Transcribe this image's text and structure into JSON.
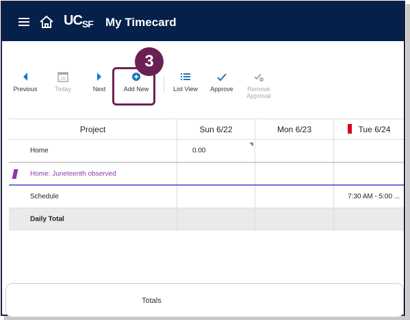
{
  "header": {
    "logo": "UCSF",
    "logo_main": "UC",
    "logo_sub": "SF",
    "title": "My Timecard",
    "background": "#052049"
  },
  "toolbar": {
    "previous": "Previous",
    "today": "Today",
    "today_date": "26",
    "next": "Next",
    "add_new": "Add New",
    "list_view": "List View",
    "approve": "Approve",
    "remove_approval": "Remove Approval",
    "accent": "#1a76c2"
  },
  "callout": {
    "number": "3",
    "color": "#6b2055"
  },
  "grid": {
    "headers": [
      "Project",
      "Sun 6/22",
      "Mon 6/23",
      "Tue 6/24"
    ],
    "rows": [
      {
        "label": "Home",
        "sun": "0.00",
        "mon": "",
        "tue": ""
      },
      {
        "label": "Home: Juneteenth observed",
        "sun": "",
        "mon": "",
        "tue": ""
      },
      {
        "label": "Schedule",
        "sun": "",
        "mon": "",
        "tue": "7:30 AM - 5:00 ..."
      },
      {
        "label": "Daily Total",
        "sun": "",
        "mon": "",
        "tue": ""
      }
    ]
  },
  "footer": {
    "label": "Totals"
  }
}
